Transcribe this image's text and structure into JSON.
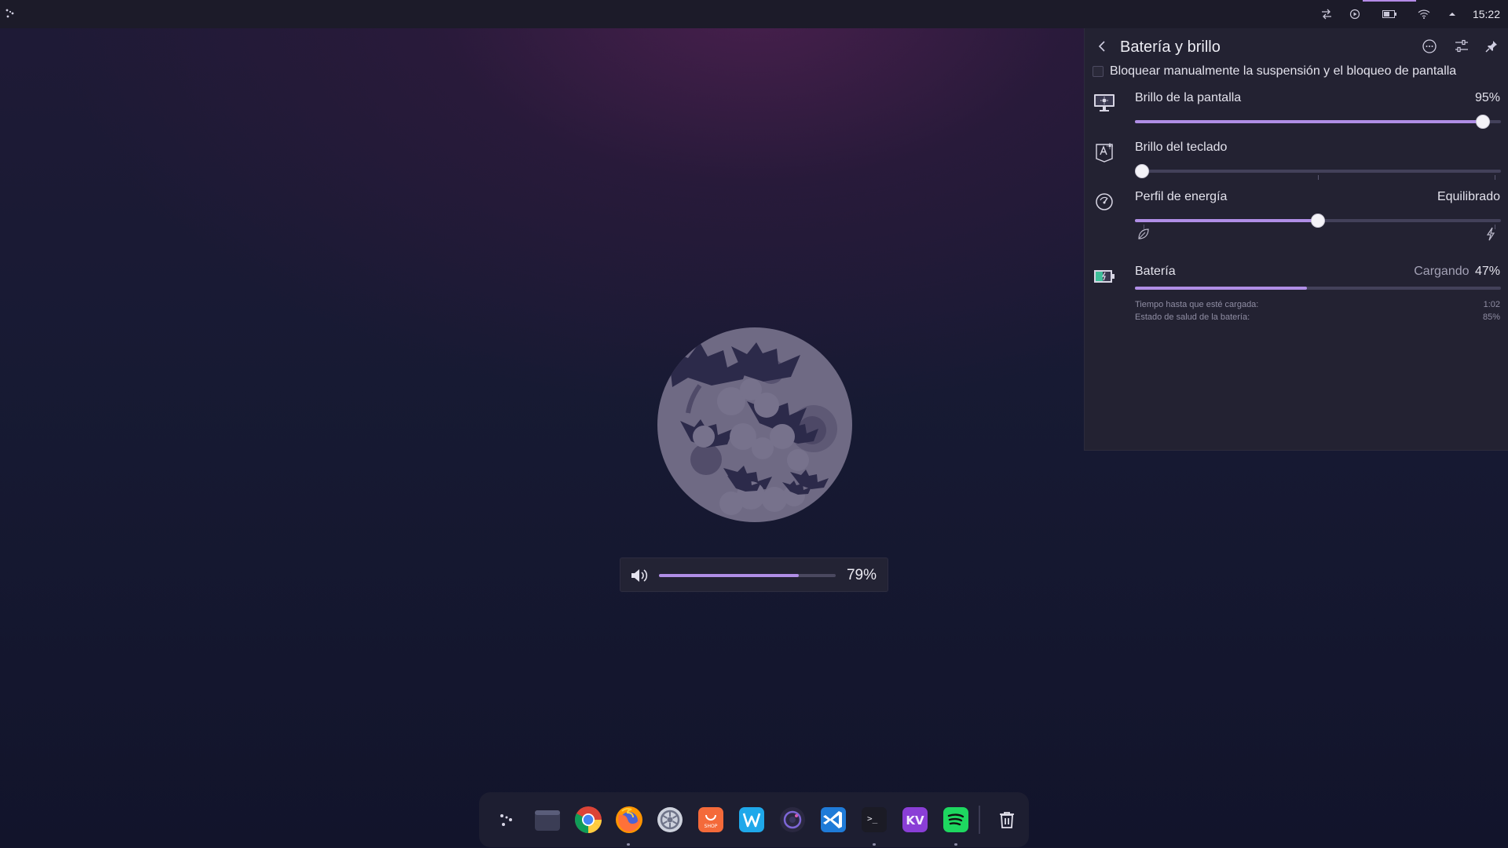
{
  "topbar": {
    "launcher_icon": "launcher-dots-icon",
    "tray": [
      {
        "icon": "sync-arrows-icon"
      },
      {
        "icon": "media-play-icon"
      },
      {
        "icon": "battery-icon",
        "active": true
      },
      {
        "icon": "wifi-icon"
      },
      {
        "icon": "chevron-up-icon"
      }
    ],
    "clock": "15:22"
  },
  "panel": {
    "title": "Batería y brillo",
    "inhibit_label": "Bloquear manualmente la suspensión y el bloqueo de pantalla",
    "inhibit_checked": false,
    "screen_brightness": {
      "label": "Brillo de la pantalla",
      "value_text": "95%",
      "value": 95
    },
    "keyboard_brightness": {
      "label": "Brillo del teclado",
      "value": 0,
      "max_steps": 2
    },
    "power_profile": {
      "label": "Perfil de energía",
      "value_text": "Equilibrado",
      "position": 1,
      "steps": 3
    },
    "battery": {
      "label": "Batería",
      "status": "Cargando",
      "percent_text": "47%",
      "percent": 47,
      "time_label": "Tiempo hasta que esté cargada:",
      "time_value": "1:02",
      "health_label": "Estado de salud de la batería:",
      "health_value": "85%"
    }
  },
  "osd": {
    "value_text": "79%",
    "value": 79
  },
  "dock": {
    "items": [
      {
        "name": "launcher",
        "icon": "launcher-dots-icon"
      },
      {
        "name": "files",
        "icon": "folder-icon"
      },
      {
        "name": "chrome",
        "icon": "chrome-icon"
      },
      {
        "name": "firefox",
        "icon": "firefox-icon"
      },
      {
        "name": "settings",
        "icon": "settings-icon"
      },
      {
        "name": "shop",
        "icon": "shop-icon",
        "label": "SHOP"
      },
      {
        "name": "writer",
        "icon": "w-app-icon"
      },
      {
        "name": "obs",
        "icon": "obs-icon"
      },
      {
        "name": "vscode",
        "icon": "vscode-icon"
      },
      {
        "name": "terminal",
        "icon": "terminal-icon",
        "label": ">_"
      },
      {
        "name": "kv",
        "icon": "kv-icon",
        "label": "KV"
      },
      {
        "name": "spotify",
        "icon": "spotify-icon"
      },
      {
        "name": "trash",
        "icon": "trash-icon"
      }
    ]
  },
  "colors": {
    "accent": "#b08ee6",
    "panel_bg": "#232232",
    "dock_bg": "#1d1e31"
  }
}
